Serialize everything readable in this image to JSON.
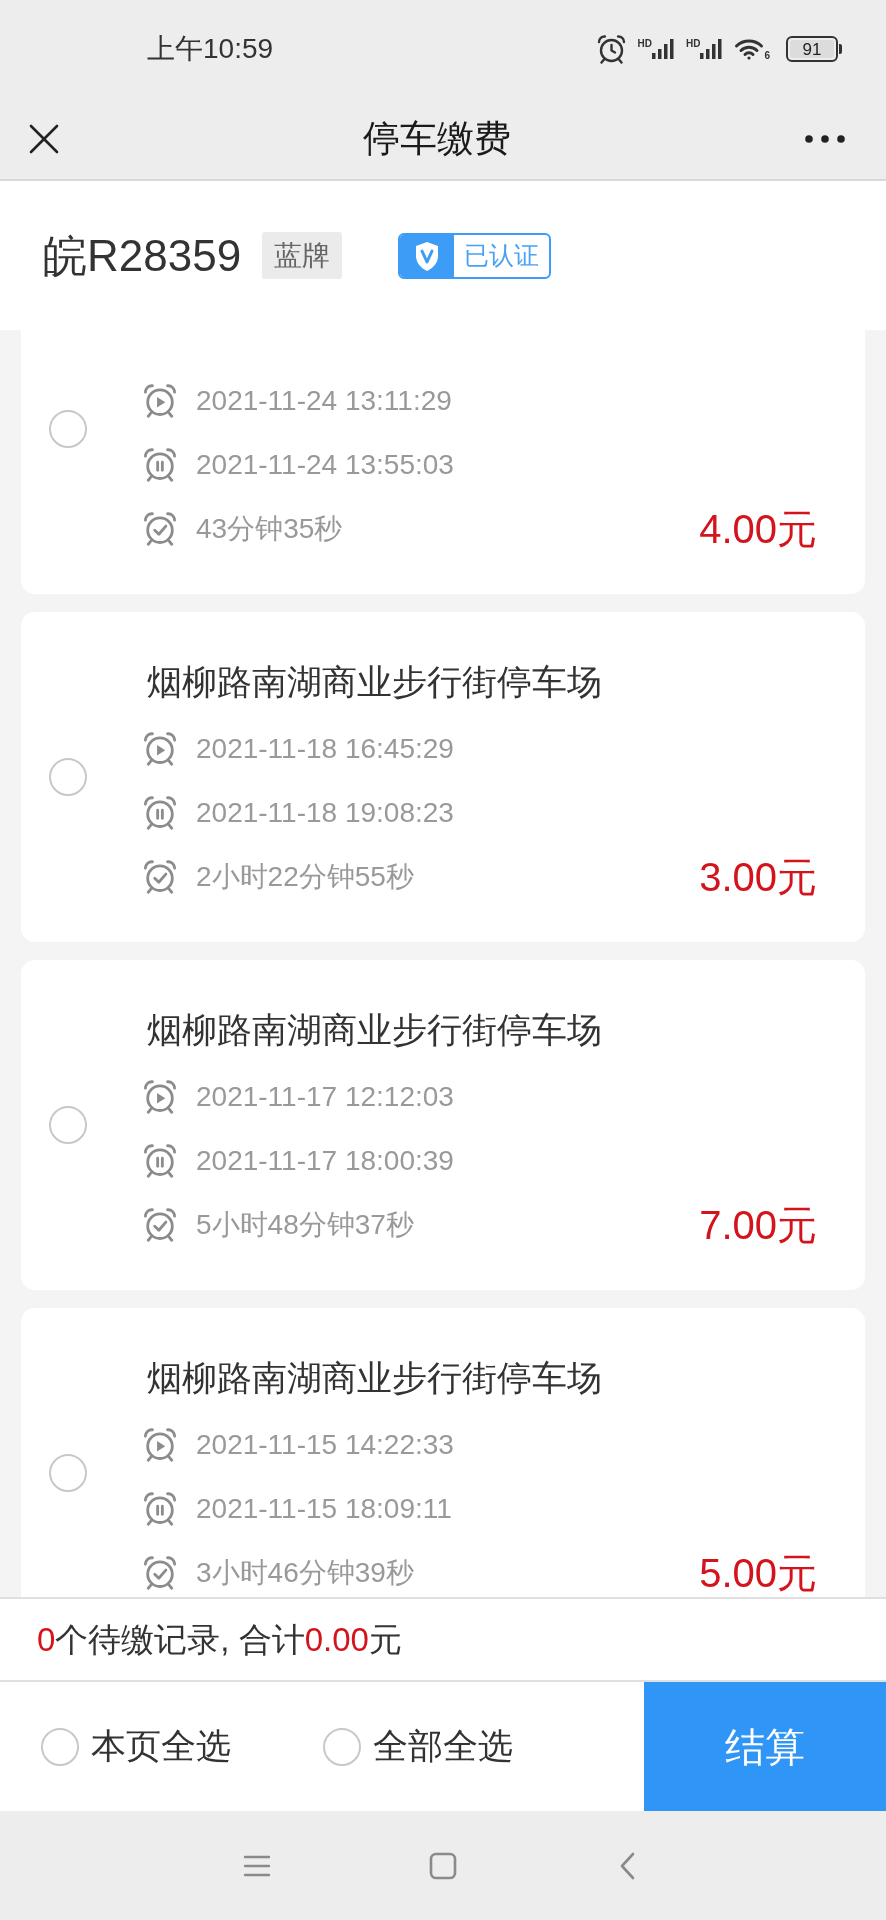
{
  "status_bar": {
    "time": "上午10:59",
    "signals": [
      {
        "label": "HD"
      },
      {
        "label": "HD"
      }
    ],
    "wifi_label": "6",
    "battery": "91"
  },
  "nav_bar": {
    "title": "停车缴费"
  },
  "vehicle": {
    "plate": "皖R28359",
    "plate_type": "蓝牌",
    "verified_label": "已认证"
  },
  "records": [
    {
      "start": "2021-11-24 13:11:29",
      "end": "2021-11-24 13:55:03",
      "duration": "43分钟35秒",
      "amount": "4.00元",
      "selected": false
    },
    {
      "title": "烟柳路南湖商业步行街停车场",
      "start": "2021-11-18 16:45:29",
      "end": "2021-11-18 19:08:23",
      "duration": "2小时22分钟55秒",
      "amount": "3.00元",
      "selected": false
    },
    {
      "title": "烟柳路南湖商业步行街停车场",
      "start": "2021-11-17 12:12:03",
      "end": "2021-11-17 18:00:39",
      "duration": "5小时48分钟37秒",
      "amount": "7.00元",
      "selected": false
    },
    {
      "title": "烟柳路南湖商业步行街停车场",
      "start": "2021-11-15 14:22:33",
      "end": "2021-11-15 18:09:11",
      "duration": "3小时46分钟39秒",
      "amount": "5.00元",
      "selected": false
    }
  ],
  "summary": {
    "count": "0",
    "count_text": "个待缴记录, 合计",
    "total": "0.00",
    "unit": "元"
  },
  "footer": {
    "options": [
      {
        "label": "本页全选",
        "checked": false
      },
      {
        "label": "全部全选",
        "checked": false
      }
    ],
    "checkout_button": "结算"
  }
}
